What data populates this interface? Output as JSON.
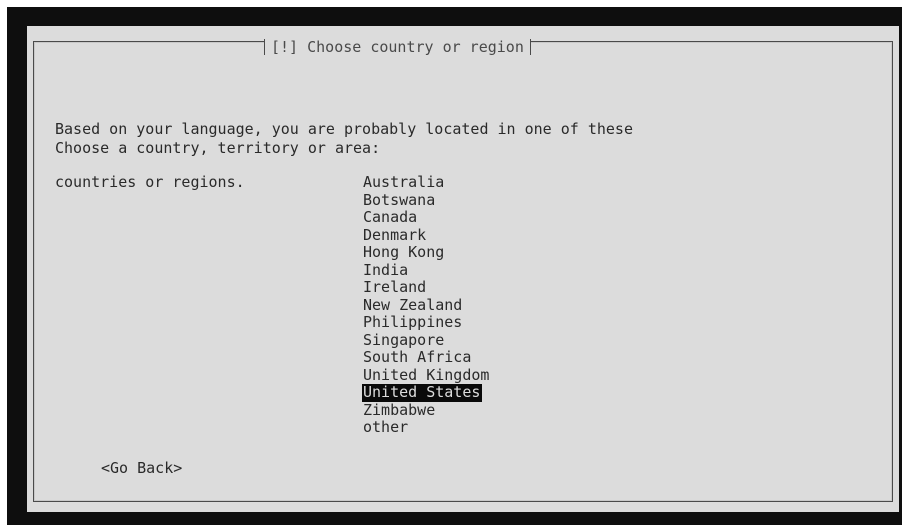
{
  "dialog": {
    "title": "[!] Choose country or region",
    "intro_line1": "Based on your language, you are probably located in one of these",
    "intro_line2": "countries or regions.",
    "prompt": "Choose a country, territory or area:",
    "items": [
      "Australia",
      "Botswana",
      "Canada",
      "Denmark",
      "Hong Kong",
      "India",
      "Ireland",
      "New Zealand",
      "Philippines",
      "Singapore",
      "South Africa",
      "United Kingdom",
      "United States",
      "Zimbabwe",
      "other"
    ],
    "selected_item": "United States",
    "go_back_label": "<Go Back>"
  },
  "colors": {
    "screen_background": "#0e0e0e",
    "dialog_background": "#dcdcdc",
    "text": "#2a2a2a",
    "selection_background": "#0a0a0a",
    "selection_text": "#dcdcdc"
  }
}
